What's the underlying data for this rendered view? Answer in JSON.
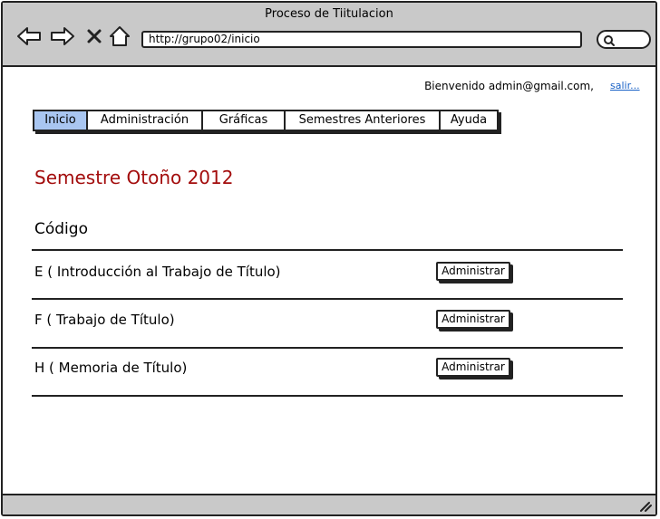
{
  "window": {
    "title": "Proceso de Tiitulacion"
  },
  "browser": {
    "url": "http://grupo02/inicio",
    "icons": [
      "back-arrow-icon",
      "forward-arrow-icon",
      "close-icon",
      "home-icon",
      "search-icon",
      "resize-grip-icon"
    ]
  },
  "header": {
    "welcome": "Bienvenido admin@gmail.com,",
    "logout": "salir..."
  },
  "tabs": [
    {
      "label": "Inicio"
    },
    {
      "label": "Administración"
    },
    {
      "label": "Gráficas"
    },
    {
      "label": "Semestres Anteriores"
    },
    {
      "label": "Ayuda"
    }
  ],
  "main": {
    "semester_title": "Semestre Otoño 2012",
    "column_header": "Código",
    "rows": [
      {
        "label": "E ( Introducción al Trabajo de Título)",
        "action": "Administrar"
      },
      {
        "label": "F ( Trabajo de Título)",
        "action": "Administrar"
      },
      {
        "label": "H ( Memoria de Título)",
        "action": "Administrar"
      }
    ]
  },
  "colors": {
    "accent_tab": "#a9c6f1",
    "title_red": "#a30d0d",
    "link_blue": "#1a62c7",
    "chrome_gray": "#c9c9c9"
  }
}
